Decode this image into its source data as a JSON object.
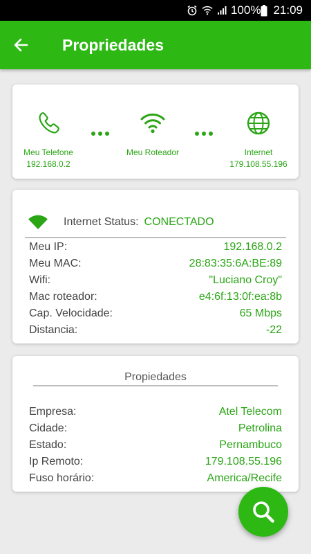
{
  "status_bar": {
    "battery": "100%",
    "time": "21:09"
  },
  "app_bar": {
    "title": "Propriedades"
  },
  "network": {
    "phone": {
      "label": "Meu Telefone",
      "ip": "192.168.0.2"
    },
    "router": {
      "label": "Meu Roteador"
    },
    "internet": {
      "label": "Internet",
      "ip": "179.108.55.196"
    }
  },
  "connection": {
    "status_label": "Internet Status:",
    "status_value": "CONECTADO",
    "rows": [
      {
        "key": "Meu IP:",
        "value": "192.168.0.2"
      },
      {
        "key": "Meu MAC:",
        "value": "28:83:35:6A:BE:89"
      },
      {
        "key": "Wifi:",
        "value": "\"Luciano Croy\""
      },
      {
        "key": "Mac roteador:",
        "value": "e4:6f:13:0f:ea:8b"
      },
      {
        "key": "Cap. Velocidade:",
        "value": "65 Mbps"
      },
      {
        "key": "Distancia:",
        "value": "-22"
      }
    ]
  },
  "properties": {
    "title": "Propiedades",
    "rows": [
      {
        "key": "Empresa:",
        "value": "Atel Telecom"
      },
      {
        "key": "Cidade:",
        "value": "Petrolina"
      },
      {
        "key": "Estado:",
        "value": "Pernambuco"
      },
      {
        "key": "Ip Remoto:",
        "value": "179.108.55.196"
      },
      {
        "key": "Fuso horário:",
        "value": "America/Recife"
      }
    ]
  },
  "colors": {
    "accent": "#2db814",
    "text_green": "#2aa515"
  }
}
